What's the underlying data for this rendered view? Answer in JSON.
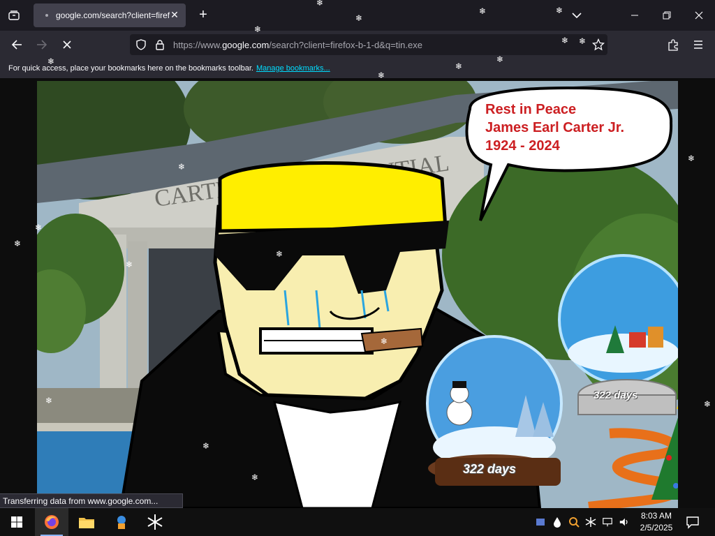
{
  "browser": {
    "tab": {
      "title": "google.com/search?client=firef",
      "close_glyph": "✕"
    },
    "new_tab_glyph": "+",
    "url": {
      "prefix": "https://www.",
      "host": "google.com",
      "path": "/search?client=firefox-b-1-d&q=tin.exe"
    },
    "bookmarks_bar": {
      "text": "For quick access, place your bookmarks here on the bookmarks toolbar.",
      "link": "Manage bookmarks..."
    },
    "status": "Transferring data from www.google.com..."
  },
  "page": {
    "speech_bubble": "Rest in Peace\nJames Earl Carter Jr.\n1924 - 2024",
    "building_sign": "CARTER  ENTIAL",
    "globe_small_label": "322 days",
    "globe_large_label": "322 days"
  },
  "taskbar": {
    "clock_time": "8:03 AM",
    "clock_date": "2/5/2025"
  },
  "colors": {
    "tab_active": "#42414d",
    "toolbar": "#2b2a33",
    "urlbar": "#1c1b22",
    "link": "#00ddff",
    "speech_text": "#cc1f22",
    "taskbar": "#101010"
  },
  "icons": [
    "tab-list-icon",
    "loading-spinner-icon",
    "close-icon",
    "plus-icon",
    "chevron-down-icon",
    "minimize-icon",
    "maximize-icon",
    "window-close-icon",
    "back-arrow-icon",
    "forward-arrow-icon",
    "stop-icon",
    "shield-icon",
    "lock-icon",
    "star-icon",
    "extensions-icon",
    "menu-icon",
    "windows-start-icon",
    "firefox-icon",
    "file-explorer-icon",
    "app-icon",
    "snowflake-app-icon",
    "network-icon",
    "volume-icon",
    "notification-icon"
  ]
}
